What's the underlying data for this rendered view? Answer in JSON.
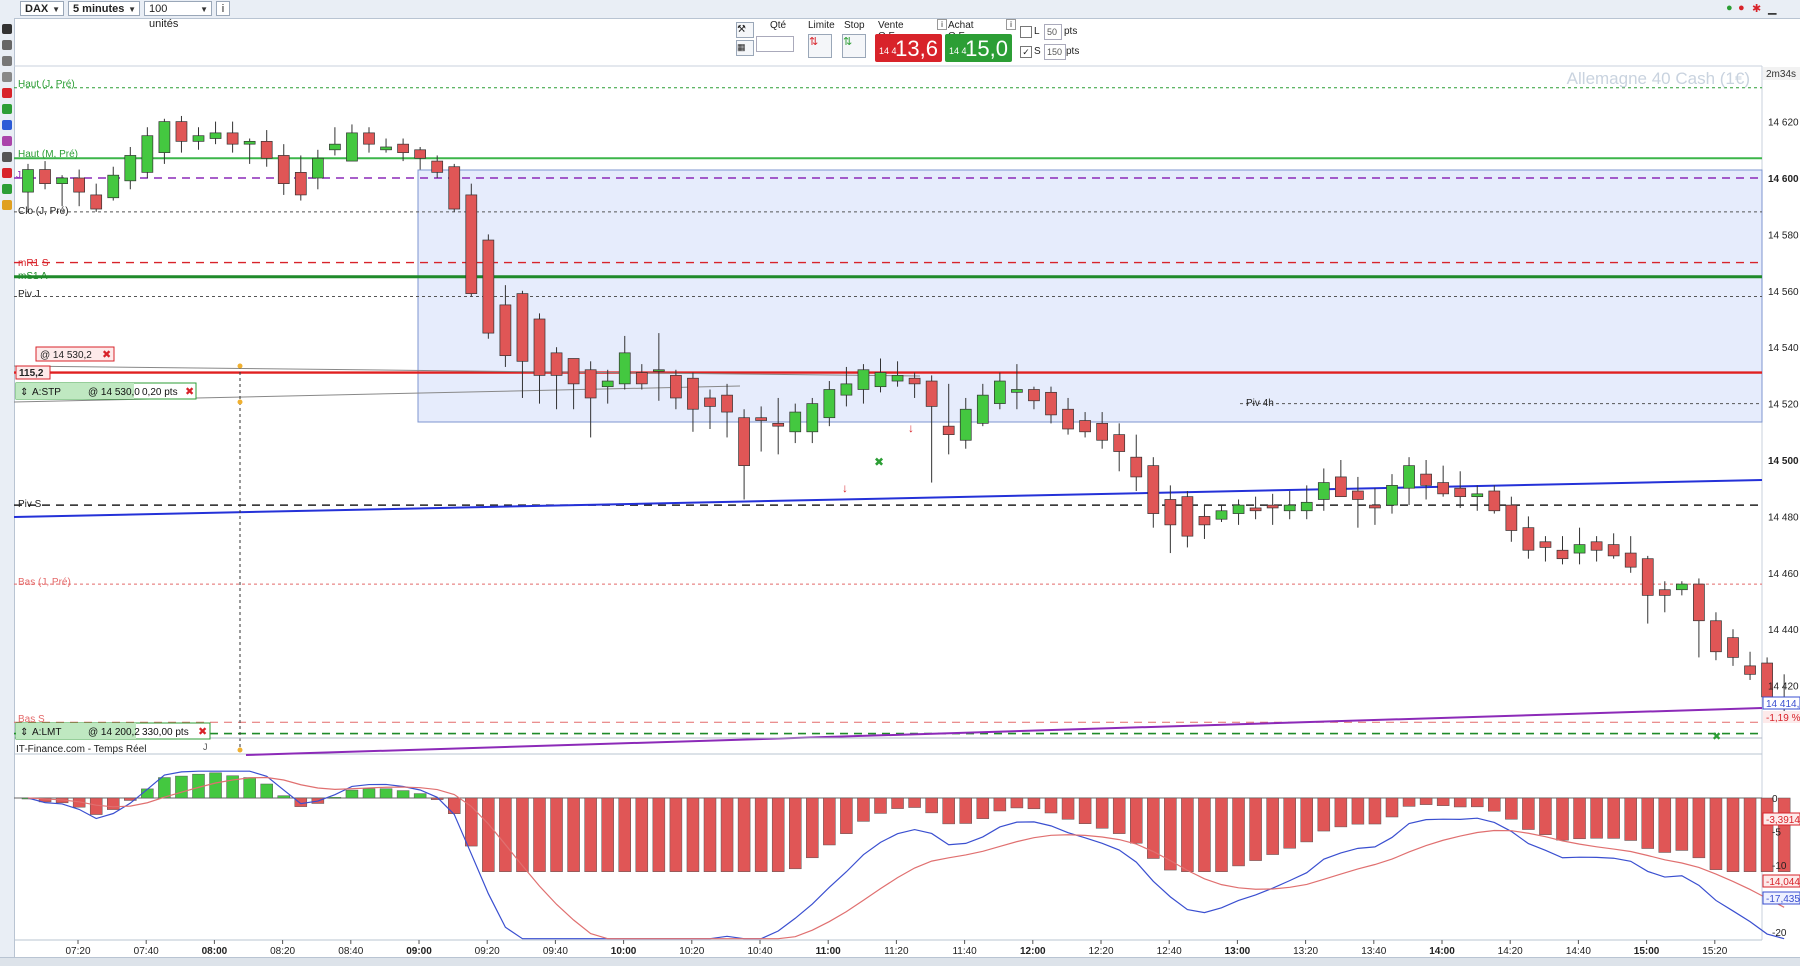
{
  "toolbar": {
    "instrument": "DAX",
    "timeframe": "5 minutes",
    "quantity_units": "100 unités"
  },
  "order_bar": {
    "qty_label": "Qté",
    "limit_label": "Limite",
    "stop_label": "Stop",
    "sell_label": "Vente O.F.",
    "buy_label": "Achat O.F.",
    "sell_prefix": "14 4",
    "sell_price": "13,6",
    "buy_prefix": "14 4",
    "buy_price": "15,0",
    "l_label": "L",
    "l_value": "50",
    "l_unit": "pts",
    "s_label": "S",
    "s_value": "150",
    "s_unit": "pts",
    "s_checked": "✓",
    "sell_color": "#d8232a",
    "buy_color": "#2c9e35"
  },
  "chart": {
    "watermark": "Allemagne 40 Cash (1€)",
    "timer": "2m34s",
    "source": "IT-Finance.com - Temps Réel",
    "j_marker": "J",
    "levels": {
      "haut_j": "Haut (J, Pré)",
      "haut_m": "Haut (M, Pré)",
      "j": "J",
      "clo_j": "Clo (J, Pré)",
      "mr1": "mR1 S",
      "ms1": "mS1 A",
      "piv_j": "Piv J",
      "piv_s": "Piv S",
      "bas_j": "Bas (J, Pré)",
      "bas_s": "Bas S",
      "piv_4h": "Piv 4h"
    },
    "orders": {
      "alert_price": "@ 14 530,2",
      "alert_value": "115,2",
      "stop_name": "A:STP",
      "stop_price": "@ 14 530,0",
      "stop_pts": "0,20 pts",
      "limit_name": "A:LMT",
      "limit_price": "@ 14 200,2",
      "limit_pts": "330,00 pts"
    },
    "price_axis": [
      "14 620",
      "14 600",
      "14 580",
      "14 560",
      "14 540",
      "14 520",
      "14 500",
      "14 480",
      "14 460",
      "14 440",
      "14 420"
    ],
    "price_axis_bold": [
      "14 600",
      "14 500"
    ],
    "current_price": "14 414,",
    "change_pct": "-1,19 %",
    "indicator_axis": [
      "0",
      "-5",
      "-10",
      "-15",
      "-20"
    ],
    "indicator_values": [
      "-3,3914",
      "-14,044",
      "-17,435"
    ],
    "time_axis": [
      "07:20",
      "07:40",
      "08:00",
      "08:20",
      "08:40",
      "09:00",
      "09:20",
      "09:40",
      "10:00",
      "10:20",
      "10:40",
      "11:00",
      "11:20",
      "11:40",
      "12:00",
      "12:20",
      "12:40",
      "13:00",
      "13:20",
      "13:40",
      "14:00",
      "14:20",
      "14:40",
      "15:00",
      "15:20"
    ],
    "time_axis_bold": [
      "08:00",
      "09:00",
      "10:00",
      "11:00",
      "12:00",
      "13:00",
      "14:00",
      "15:00"
    ]
  },
  "chart_data": {
    "type": "candlestick",
    "symbol": "DAX",
    "interval": "5 minutes",
    "ylim": [
      14400,
      14640
    ],
    "candles": [
      [
        14595,
        14605,
        14588,
        14603
      ],
      [
        14603,
        14606,
        14596,
        14598
      ],
      [
        14598,
        14601,
        14590,
        14600
      ],
      [
        14600,
        14603,
        14590,
        14595
      ],
      [
        14594,
        14598,
        14588,
        14589
      ],
      [
        14593,
        14604,
        14592,
        14601
      ],
      [
        14599,
        14611,
        14596,
        14608
      ],
      [
        14602,
        14618,
        14600,
        14615
      ],
      [
        14609,
        14621,
        14605,
        14620
      ],
      [
        14620,
        14622,
        14609,
        14613
      ],
      [
        14613,
        14618,
        14610,
        14615
      ],
      [
        14614,
        14620,
        14612,
        14616
      ],
      [
        14616,
        14620,
        14609,
        14612
      ],
      [
        14612,
        14614,
        14605,
        14613
      ],
      [
        14613,
        14617,
        14604,
        14607
      ],
      [
        14608,
        14612,
        14594,
        14598
      ],
      [
        14602,
        14608,
        14592,
        14594
      ],
      [
        14600,
        14610,
        14596,
        14607
      ],
      [
        14610,
        14618,
        14608,
        14612
      ],
      [
        14606,
        14619,
        14606,
        14616
      ],
      [
        14616,
        14618,
        14609,
        14612
      ],
      [
        14610,
        14614,
        14609,
        14611
      ],
      [
        14612,
        14614,
        14606,
        14609
      ],
      [
        14610,
        14611,
        14603,
        14607
      ],
      [
        14606,
        14608,
        14600,
        14602
      ],
      [
        14604,
        14605,
        14588,
        14589
      ],
      [
        14594,
        14598,
        14558,
        14559
      ],
      [
        14578,
        14580,
        14543,
        14545
      ],
      [
        14555,
        14562,
        14533,
        14537
      ],
      [
        14559,
        14560,
        14522,
        14535
      ],
      [
        14550,
        14552,
        14520,
        14530
      ],
      [
        14538,
        14540,
        14518,
        14530
      ],
      [
        14536,
        14536,
        14518,
        14527
      ],
      [
        14532,
        14535,
        14508,
        14522
      ],
      [
        14526,
        14532,
        14520,
        14528
      ],
      [
        14527,
        14544,
        14525,
        14538
      ],
      [
        14531,
        14534,
        14525,
        14527
      ],
      [
        14532,
        14545,
        14521,
        14532
      ],
      [
        14530,
        14532,
        14518,
        14522
      ],
      [
        14529,
        14531,
        14510,
        14518
      ],
      [
        14522,
        14525,
        14511,
        14519
      ],
      [
        14523,
        14527,
        14508,
        14517
      ],
      [
        14515,
        14518,
        14486,
        14498
      ],
      [
        14515,
        14519,
        14503,
        14514
      ],
      [
        14513,
        14522,
        14502,
        14512
      ],
      [
        14510,
        14520,
        14506,
        14517
      ],
      [
        14510,
        14522,
        14506,
        14520
      ],
      [
        14515,
        14528,
        14512,
        14525
      ],
      [
        14523,
        14533,
        14519,
        14527
      ],
      [
        14525,
        14534,
        14520,
        14532
      ],
      [
        14526,
        14536,
        14524,
        14531
      ],
      [
        14528,
        14535,
        14526,
        14530
      ],
      [
        14529,
        14531,
        14522,
        14527
      ],
      [
        14528,
        14530,
        14492,
        14519
      ],
      [
        14512,
        14527,
        14502,
        14509
      ],
      [
        14507,
        14522,
        14504,
        14518
      ],
      [
        14513,
        14527,
        14512,
        14523
      ],
      [
        14520,
        14531,
        14518,
        14528
      ],
      [
        14524,
        14534,
        14518,
        14525
      ],
      [
        14525,
        14526,
        14518,
        14521
      ],
      [
        14524,
        14526,
        14513,
        14516
      ],
      [
        14518,
        14522,
        14509,
        14511
      ],
      [
        14514,
        14517,
        14508,
        14510
      ],
      [
        14513,
        14517,
        14504,
        14507
      ],
      [
        14509,
        14513,
        14496,
        14503
      ],
      [
        14501,
        14509,
        14489,
        14494
      ],
      [
        14498,
        14501,
        14476,
        14481
      ],
      [
        14486,
        14491,
        14467,
        14477
      ],
      [
        14487,
        14489,
        14469,
        14473
      ],
      [
        14480,
        14484,
        14472,
        14477
      ],
      [
        14479,
        14484,
        14478,
        14482
      ],
      [
        14481,
        14486,
        14477,
        14484
      ],
      [
        14483,
        14487,
        14479,
        14482
      ],
      [
        14484,
        14488,
        14477,
        14483
      ],
      [
        14482,
        14489,
        14479,
        14484
      ],
      [
        14482,
        14491,
        14479,
        14485
      ],
      [
        14486,
        14497,
        14482,
        14492
      ],
      [
        14494,
        14500,
        14488,
        14487
      ],
      [
        14489,
        14494,
        14476,
        14486
      ],
      [
        14484,
        14490,
        14477,
        14483
      ],
      [
        14484,
        14495,
        14481,
        14491
      ],
      [
        14490,
        14501,
        14484,
        14498
      ],
      [
        14495,
        14500,
        14486,
        14491
      ],
      [
        14492,
        14498,
        14487,
        14488
      ],
      [
        14490,
        14496,
        14483,
        14487
      ],
      [
        14487,
        14491,
        14482,
        14488
      ],
      [
        14489,
        14491,
        14481,
        14482
      ],
      [
        14484,
        14487,
        14471,
        14475
      ],
      [
        14476,
        14480,
        14465,
        14468
      ],
      [
        14471,
        14473,
        14464,
        14469
      ],
      [
        14468,
        14473,
        14463,
        14465
      ],
      [
        14467,
        14476,
        14463,
        14470
      ],
      [
        14471,
        14473,
        14464,
        14468
      ],
      [
        14470,
        14474,
        14465,
        14466
      ],
      [
        14467,
        14473,
        14460,
        14462
      ],
      [
        14465,
        14466,
        14442,
        14452
      ],
      [
        14454,
        14457,
        14446,
        14452
      ],
      [
        14454,
        14457,
        14452,
        14456
      ],
      [
        14456,
        14458,
        14430,
        14443
      ],
      [
        14443,
        14446,
        14429,
        14432
      ],
      [
        14437,
        14440,
        14427,
        14430
      ],
      [
        14427,
        14432,
        14422,
        14424
      ],
      [
        14428,
        14430,
        14414,
        14416
      ],
      [
        14416,
        14424,
        14410,
        14413
      ]
    ],
    "oscillator": {
      "histogram_note": "MACD-like histogram in lower pane",
      "ylim": [
        -22,
        5
      ]
    }
  }
}
